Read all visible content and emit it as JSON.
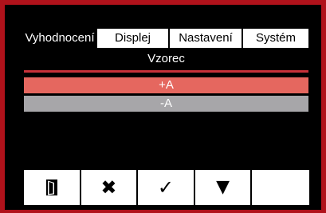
{
  "tabs": [
    {
      "label": "Vyhodnocení",
      "active": true
    },
    {
      "label": "Displej",
      "active": false
    },
    {
      "label": "Nastavení",
      "active": false
    },
    {
      "label": "Systém",
      "active": false
    }
  ],
  "section": {
    "title": "Vzorec"
  },
  "rows": [
    {
      "label": "+A",
      "selected": true
    },
    {
      "label": "-A",
      "selected": false
    }
  ],
  "toolbar": {
    "buttons": [
      {
        "icon": "exit-door-icon"
      },
      {
        "icon": "close-icon",
        "glyph": "✖"
      },
      {
        "icon": "check-icon",
        "glyph": "✓"
      },
      {
        "icon": "arrow-down-icon",
        "glyph": "▼"
      },
      {
        "icon": "empty"
      }
    ]
  },
  "colors": {
    "frame": "#b0121b",
    "background": "#000000",
    "selected_row": "#e5675f",
    "unselected_row": "#a7a6a9",
    "rule": "#c8323a"
  }
}
